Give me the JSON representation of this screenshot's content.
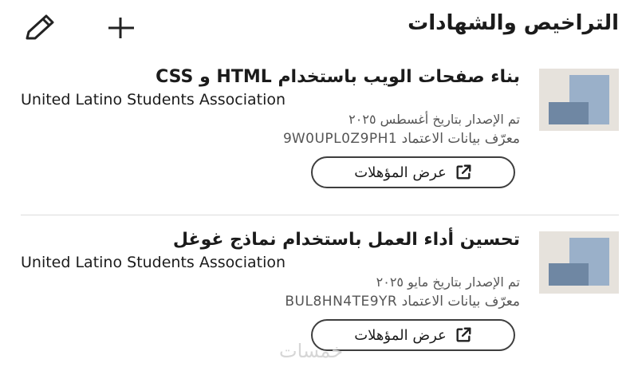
{
  "section": {
    "title": "التراخيص والشهادات",
    "add_icon": "plus-icon",
    "edit_icon": "pencil-icon"
  },
  "certifications": [
    {
      "title_ar": "بناء صفحات الويب باستخدام",
      "title_html": "HTML",
      "title_and": "و",
      "title_css": "CSS",
      "issuer": "United Latino Students Association",
      "issued": "تم الإصدار بتاريخ أغسطس ٢٠٢٥",
      "credential_label": "معرّف بيانات الاعتماد",
      "credential_id": "9W0UPL0Z9PH1",
      "button_label": "عرض المؤهلات",
      "button_icon": "external-link-icon"
    },
    {
      "title": "تحسين أداء العمل باستخدام نماذج غوغل",
      "issuer": "United Latino Students Association",
      "issued": "تم الإصدار بتاريخ مايو ٢٠٢٥",
      "credential_label": "معرّف بيانات الاعتماد",
      "credential_id": "BUL8HN4TE9YR",
      "button_label": "عرض المؤهلات",
      "button_icon": "external-link-icon"
    }
  ],
  "watermark": "خمسات",
  "colors": {
    "logo_bg": "#e6e2dc",
    "logo_back": "#9ab0c9",
    "logo_front": "#6f87a3",
    "text": "#1b1b1b",
    "secondary_text": "#555555"
  }
}
